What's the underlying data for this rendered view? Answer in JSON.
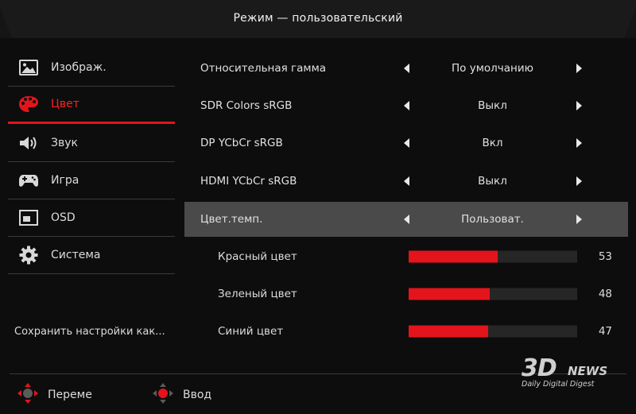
{
  "header": {
    "title": "Режим — пользовательский"
  },
  "sidebar": {
    "items": [
      {
        "label": "Изображ.",
        "icon": "image-icon",
        "active": false
      },
      {
        "label": "Цвет",
        "icon": "palette-icon",
        "active": true
      },
      {
        "label": "Звук",
        "icon": "speaker-icon",
        "active": false
      },
      {
        "label": "Игра",
        "icon": "gamepad-icon",
        "active": false
      },
      {
        "label": "OSD",
        "icon": "osd-window-icon",
        "active": false
      },
      {
        "label": "Система",
        "icon": "gear-icon",
        "active": false
      }
    ],
    "save_label": "Сохранить настройки как..."
  },
  "settings": [
    {
      "label": "Относительная гамма",
      "value": "По умолчанию"
    },
    {
      "label": "SDR Colors sRGB",
      "value": "Выкл"
    },
    {
      "label": "DP YCbCr sRGB",
      "value": "Вкл"
    },
    {
      "label": "HDMI YCbCr sRGB",
      "value": "Выкл"
    },
    {
      "label": "Цвет.темп.",
      "value": "Пользоват.",
      "selected": true
    }
  ],
  "sliders": [
    {
      "label": "Красный цвет",
      "value": "53",
      "level": 53
    },
    {
      "label": "Зеленый цвет",
      "value": "48",
      "level": 48
    },
    {
      "label": "Синий цвет",
      "value": "47",
      "level": 47
    }
  ],
  "footer": {
    "move_label": "Переме",
    "enter_label": "Ввод"
  },
  "watermark": {
    "logo": "3D",
    "news": "NEWS",
    "tagline": "Daily Digital Digest"
  },
  "colors": {
    "accent": "#e4141c",
    "selected_row": "#4a4a4a",
    "background": "#0d0d0d"
  }
}
